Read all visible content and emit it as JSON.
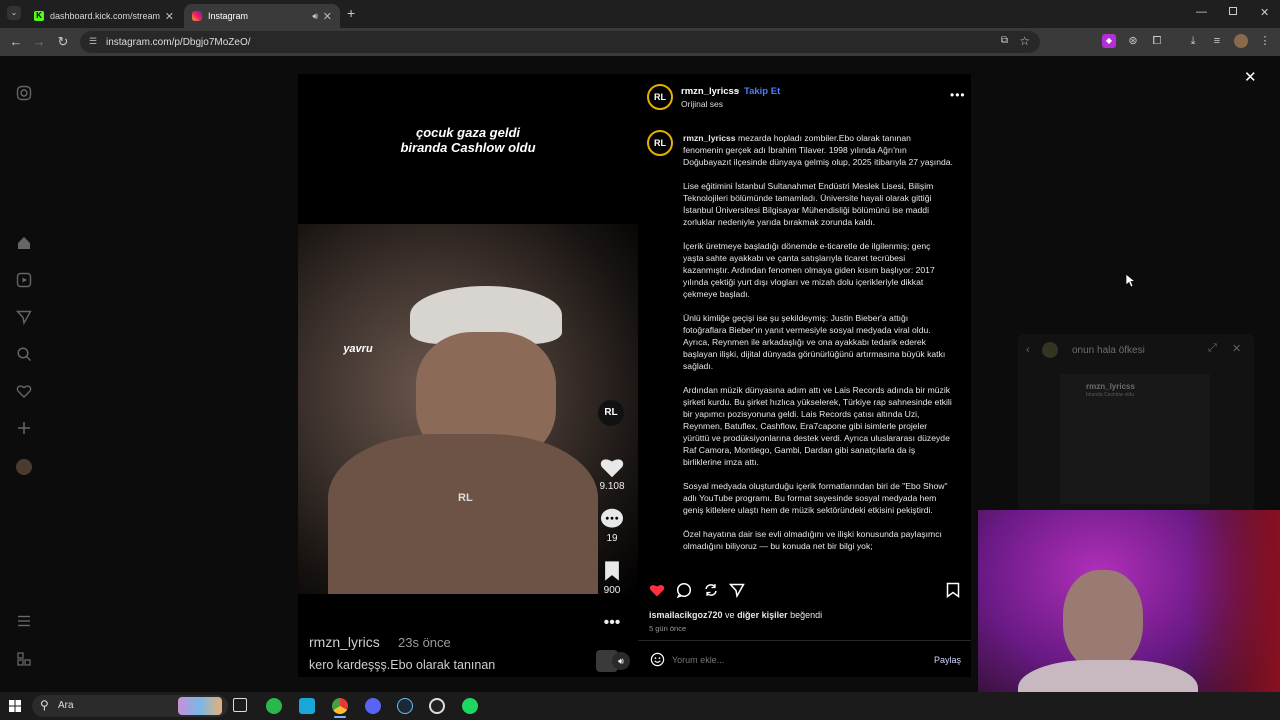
{
  "browser": {
    "tabs": [
      {
        "label": "dashboard.kick.com/stream",
        "active": false
      },
      {
        "label": "Instagram",
        "active": true
      }
    ],
    "new_tab": "+",
    "url": "instagram.com/p/Dbgjo7MoZeO/"
  },
  "post": {
    "video_caption_line1": "çocuk gaza geldi",
    "video_caption_line2": "biranda Cashlow oldu",
    "video_subtitle": "yavru",
    "likes": "9.108",
    "comments": "19",
    "saves": "900",
    "video_user": "rmzn_lyrics",
    "video_time": "23s önce",
    "video_text": "kero kardeşşş.Ebo olarak tanınan",
    "username": "rmzn_lyricss",
    "separator": "•",
    "follow": "Takip Et",
    "audio": "Orijinal ses",
    "desc_user": "rmzn_lyricss",
    "desc_first": " mezarda hopladı zombiler.Ebo olarak tanınan fenomenin gerçek adı İbrahim Tilaver. 1998 yılında Ağrı'nın Doğubayazıt ilçesinde dünyaya gelmiş olup, 2025 itibarıyla 27 yaşında.",
    "desc_paragraphs": [
      "Lise eğitimini İstanbul Sultanahmet Endüstri Meslek Lisesi, Bilişim Teknolojileri bölümünde tamamladı. Üniversite hayali olarak gittiği İstanbul Üniversitesi Bilgisayar Mühendisliği bölümünü ise maddi zorluklar nedeniyle yarıda bırakmak zorunda kaldı.",
      "İçerik üretmeye başladığı dönemde e-ticaretle de ilgilenmiş; genç yaşta sahte ayakkabı ve çanta satışlarıyla ticaret tecrübesi kazanmıştır. Ardından fenomen olmaya giden kısım başlıyor: 2017 yılında çektiği yurt dışı vlogları ve mizah dolu içerikleriyle dikkat çekmeye başladı.",
      "Ünlü kimliğe geçişi ise şu şekildeymiş: Justin Bieber'a attığı fotoğraflara Bieber'ın yanıt vermesiyle sosyal medyada viral oldu. Ayrıca, Reynmen ile arkadaşlığı ve ona ayakkabı tedarik ederek başlayan ilişki, dijital dünyada görünürlüğünü artırmasına büyük katkı sağladı.",
      "Ardından müzik dünyasına adım attı ve Lais Records adında bir müzik şirketi kurdu. Bu şirket hızlıca yükselerek, Türkiye rap sahnesinde etkili bir yapımcı pozisyonuna geldi. Lais Records çatısı altında Uzi, Reynmen, Batuflex, Cashflow, Era7capone gibi isimlerle projeler yürüttü ve prodüksiyonlarına destek verdi. Ayrıca uluslararası düzeyde Raf Camora, Montiego, Gambi, Dardan gibi sanatçılarla da iş birliklerine imza attı.",
      "Sosyal medyada oluşturduğu içerik formatlarından biri de \"Ebo Show\" adlı YouTube programı. Bu format sayesinde sosyal medyada hem geniş kitlelere ulaştı hem de müzik sektöründeki etkisini pekiştirdi.",
      "Özel hayatına dair ise evli olmadığını ve ilişki konusunda paylaşımcı olmadığını biliyoruz — bu konuda net bir bilgi yok;"
    ],
    "liked_by_user": "ismailacikgoz720",
    "liked_by_mid": " ve ",
    "liked_by_others": "diğer kişiler",
    "liked_by_end": " beğendi",
    "posted": "5 gün önce",
    "comment_placeholder": "Yorum ekle...",
    "share": "Paylaş",
    "avatar_text": "RL"
  },
  "overlay": {
    "title": "onun hala öfkesi",
    "mini_user": "rmzn_lyricss",
    "mini_caption": "biranda Cashlow oldu"
  },
  "taskbar": {
    "search": "Ara"
  },
  "colors": {
    "accent": "#4a7dff",
    "like": "#ff3040",
    "chrome_dark": "#1f1f1f",
    "chrome_bar": "#3a3a3a"
  }
}
